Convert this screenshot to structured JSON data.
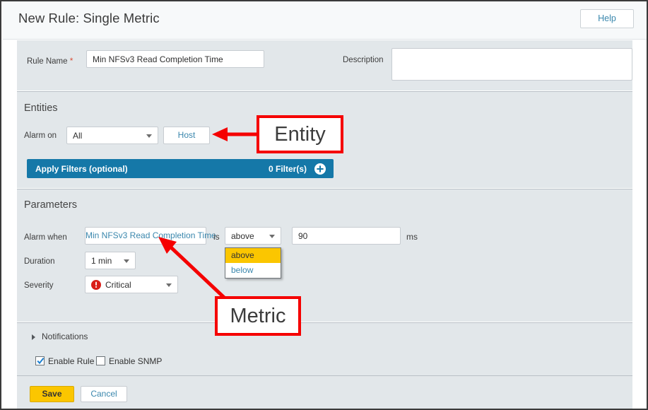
{
  "header": {
    "title": "New Rule: Single Metric",
    "help_label": "Help"
  },
  "rule_name_section": {
    "label": "Rule Name",
    "required_marker": "*",
    "value": "Min NFSv3 Read Completion Time",
    "description_label": "Description",
    "description_value": ""
  },
  "entities": {
    "section_title": "Entities",
    "alarm_on_label": "Alarm on",
    "alarm_on_value": "All",
    "alarm_on_options": [
      "All"
    ],
    "entity_tab_label": "Host",
    "filters": {
      "label": "Apply Filters (optional)",
      "count_label": "0 Filter(s)",
      "add_icon": "plus-circle-icon",
      "bar_color": "#1578a8"
    }
  },
  "parameters": {
    "section_title": "Parameters",
    "alarm_when_label": "Alarm when",
    "metric_value": "Min NFSv3 Read Completion Time",
    "is_label": "is",
    "comparison_value": "above",
    "comparison_options": [
      "above",
      "below"
    ],
    "comparison_selected_index": 0,
    "threshold_value": "90",
    "unit_label": "ms",
    "duration_label": "Duration",
    "duration_value": "1 min",
    "severity_label": "Severity",
    "severity_value": "Critical",
    "severity_icon": "critical-alert-icon",
    "severity_icon_color": "#d91e18"
  },
  "notifications": {
    "label": "Notifications",
    "expander_icon": "chevron-right-icon",
    "enable_rule_label": "Enable Rule",
    "enable_rule_checked": true,
    "enable_snmp_label": "Enable SNMP",
    "enable_snmp_checked": false
  },
  "footer": {
    "save_label": "Save",
    "cancel_label": "Cancel",
    "save_color": "#fbc600"
  },
  "annotations": {
    "entity_label": "Entity",
    "metric_label": "Metric",
    "color": "#f50000"
  }
}
